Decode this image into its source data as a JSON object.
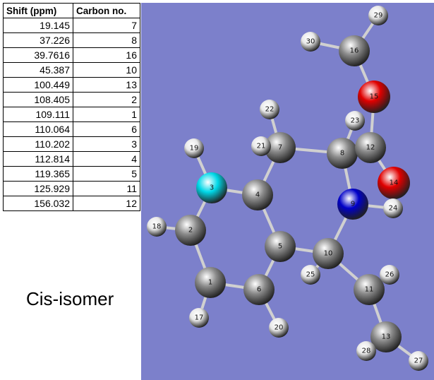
{
  "table": {
    "headers": {
      "shift": "Shift (ppm)",
      "carbon": "Carbon no."
    },
    "rows": [
      {
        "shift": "19.145",
        "carbon": "7"
      },
      {
        "shift": "37.226",
        "carbon": "8"
      },
      {
        "shift": "39.7616",
        "carbon": "16"
      },
      {
        "shift": "45.387",
        "carbon": "10"
      },
      {
        "shift": "100.449",
        "carbon": "13"
      },
      {
        "shift": "108.405",
        "carbon": "2"
      },
      {
        "shift": "109.111",
        "carbon": "1"
      },
      {
        "shift": "110.064",
        "carbon": "6"
      },
      {
        "shift": "110.202",
        "carbon": "3"
      },
      {
        "shift": "112.814",
        "carbon": "4"
      },
      {
        "shift": "119.365",
        "carbon": "5"
      },
      {
        "shift": "125.929",
        "carbon": "11"
      },
      {
        "shift": "156.032",
        "carbon": "12"
      }
    ]
  },
  "isomer_label": "Cis-isomer",
  "molecule": {
    "background_color": "#7c80cb",
    "element_colors": {
      "C": "#8a8a8a",
      "H": "#e8e8e8",
      "O": "#e00000",
      "N": "#0000c8",
      "F": "#00d8e8"
    },
    "atoms": [
      {
        "label": "1",
        "element": "C"
      },
      {
        "label": "2",
        "element": "C"
      },
      {
        "label": "3",
        "element": "F"
      },
      {
        "label": "4",
        "element": "C"
      },
      {
        "label": "5",
        "element": "C"
      },
      {
        "label": "6",
        "element": "C"
      },
      {
        "label": "7",
        "element": "C"
      },
      {
        "label": "8",
        "element": "C"
      },
      {
        "label": "9",
        "element": "N"
      },
      {
        "label": "10",
        "element": "C"
      },
      {
        "label": "11",
        "element": "C"
      },
      {
        "label": "12",
        "element": "C"
      },
      {
        "label": "13",
        "element": "C"
      },
      {
        "label": "14",
        "element": "O"
      },
      {
        "label": "15",
        "element": "O"
      },
      {
        "label": "16",
        "element": "C"
      },
      {
        "label": "17",
        "element": "H"
      },
      {
        "label": "18",
        "element": "H"
      },
      {
        "label": "19",
        "element": "H"
      },
      {
        "label": "20",
        "element": "H"
      },
      {
        "label": "21",
        "element": "H"
      },
      {
        "label": "22",
        "element": "H"
      },
      {
        "label": "23",
        "element": "H"
      },
      {
        "label": "24",
        "element": "H"
      },
      {
        "label": "25",
        "element": "H"
      },
      {
        "label": "26",
        "element": "H"
      },
      {
        "label": "27",
        "element": "H"
      },
      {
        "label": "28",
        "element": "H"
      },
      {
        "label": "29",
        "element": "H"
      },
      {
        "label": "30",
        "element": "H"
      }
    ]
  }
}
